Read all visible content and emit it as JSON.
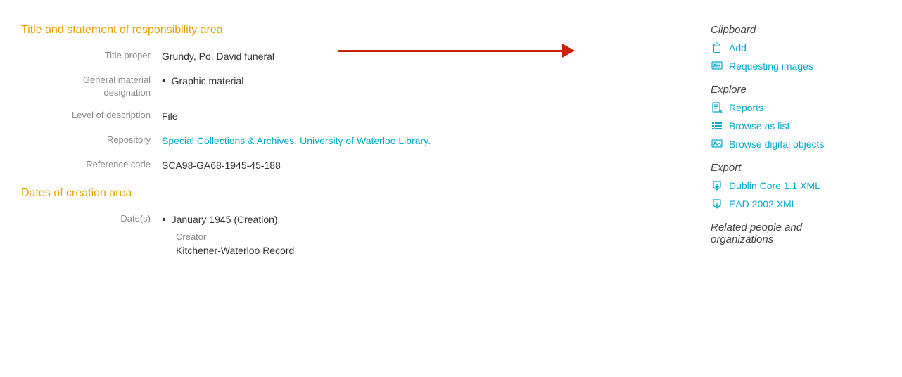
{
  "main": {
    "title_section": "Title and statement of responsibility area",
    "dates_section": "Dates of creation area",
    "fields": [
      {
        "label": "Title proper",
        "value": "Grundy, Po. David funeral",
        "type": "text",
        "has_arrow": true
      },
      {
        "label": "General material designation",
        "value": "Graphic material",
        "type": "bullet"
      },
      {
        "label": "Level of description",
        "value": "File",
        "type": "text"
      },
      {
        "label": "Repository",
        "value": "Special Collections & Archives. University of Waterloo Library.",
        "type": "link"
      },
      {
        "label": "Reference code",
        "value": "SCA98-GA68-1945-45-188",
        "type": "text"
      }
    ],
    "date_fields": [
      {
        "label": "Date(s)",
        "value": "January 1945 (Creation)",
        "sub_label": "Creator",
        "sub_value": "Kitchener-Waterloo Record",
        "type": "bullet_sub"
      }
    ]
  },
  "sidebar": {
    "clipboard_title": "Clipboard",
    "add_label": "Add",
    "requesting_images_label": "Requesting images",
    "explore_title": "Explore",
    "reports_label": "Reports",
    "browse_list_label": "Browse as list",
    "browse_digital_label": "Browse digital objects",
    "export_title": "Export",
    "dublin_core_label": "Dublin Core 1.1 XML",
    "ead_xml_label": "EAD 2002 XML",
    "related_title": "Related people and organizations"
  },
  "icons": {
    "add": "🔗",
    "image": "🖼",
    "report": "🖨",
    "list": "☰",
    "digital": "🖼",
    "export": "⬆",
    "export2": "⬆"
  }
}
